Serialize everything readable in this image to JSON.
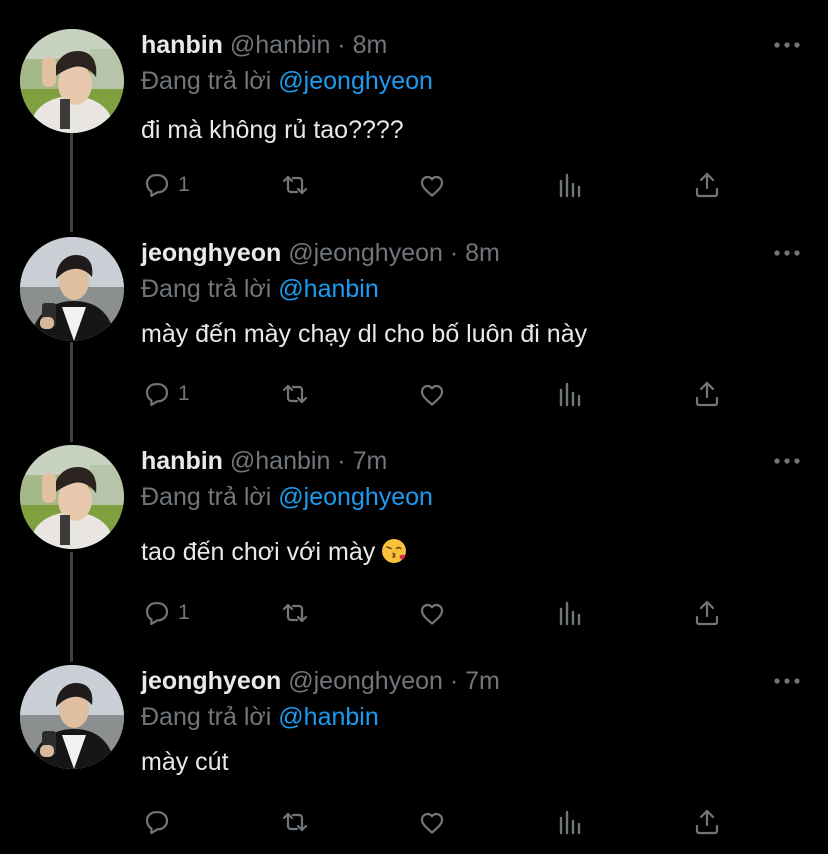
{
  "tweets": [
    {
      "name": "hanbin",
      "handle": "@hanbin",
      "dot": "·",
      "time": "8m",
      "reply_prefix": "Đang trả lời",
      "reply_mention": "@jeonghyeon",
      "text": "đi mà không rủ tao????",
      "reply_count": "1",
      "avatar": "hanbin-avatar"
    },
    {
      "name": "jeonghyeon",
      "handle": "@jeonghyeon",
      "dot": "·",
      "time": "8m",
      "reply_prefix": "Đang trả lời",
      "reply_mention": "@hanbin",
      "text": "mày đến mày chạy dl cho bố luôn đi này",
      "reply_count": "1",
      "avatar": "jeonghyeon-avatar"
    },
    {
      "name": "hanbin",
      "handle": "@hanbin",
      "dot": "·",
      "time": "7m",
      "reply_prefix": "Đang trả lời",
      "reply_mention": "@jeonghyeon",
      "text": "tao đến chơi với mày",
      "emoji": "kissing-face-emoji",
      "reply_count": "1",
      "avatar": "hanbin-avatar"
    },
    {
      "name": "jeonghyeon",
      "handle": "@jeonghyeon",
      "dot": "·",
      "time": "7m",
      "reply_prefix": "Đang trả lời",
      "reply_mention": "@hanbin",
      "text": "mày cút",
      "reply_count": "",
      "avatar": "jeonghyeon-avatar"
    }
  ],
  "icons": {
    "more": "more-icon",
    "reply": "reply-icon",
    "retweet": "retweet-icon",
    "like": "like-icon",
    "views": "views-icon",
    "share": "share-icon"
  },
  "colors": {
    "background": "#000000",
    "primary_text": "#e7e9ea",
    "secondary_text": "#71767b",
    "mention": "#1d9bf0",
    "thread_line": "#3d4145"
  }
}
